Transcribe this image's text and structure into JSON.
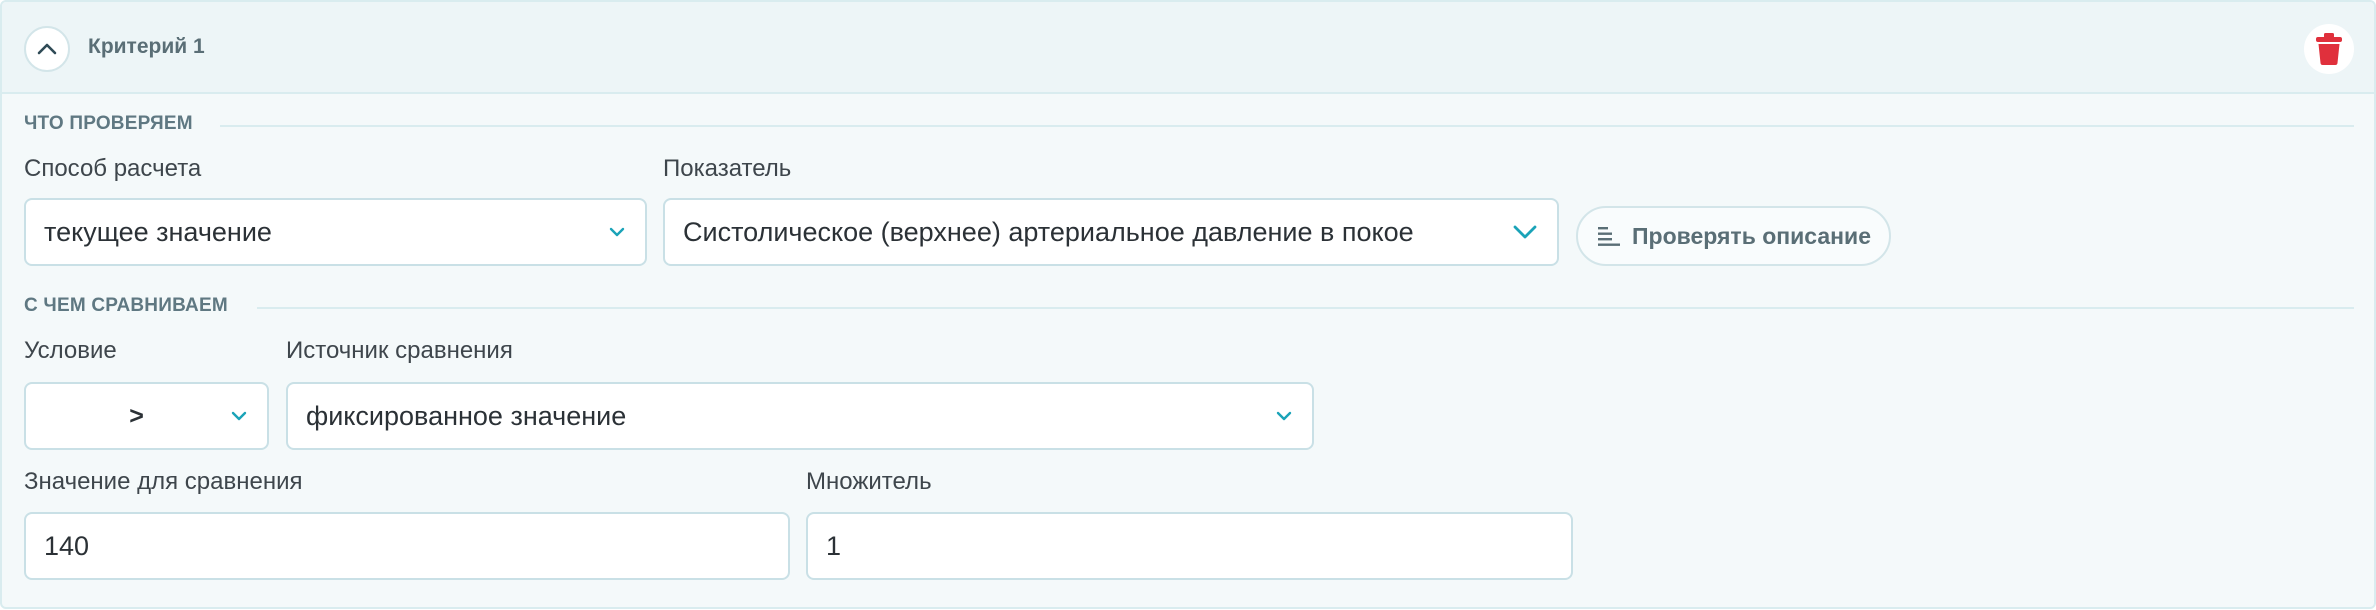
{
  "criterion": {
    "title": "Критерий 1"
  },
  "what_section": {
    "title": "ЧТО ПРОВЕРЯЕМ",
    "calc_method_label": "Способ расчета",
    "calc_method_value": "текущее значение",
    "indicator_label": "Показатель",
    "indicator_value": "Систолическое (верхнее) артериальное давление в покое",
    "check_description_button": "Проверять описание"
  },
  "compare_section": {
    "title": "С ЧЕМ СРАВНИВАЕМ",
    "condition_label": "Условие",
    "condition_value": ">",
    "source_label": "Источник сравнения",
    "source_value": "фиксированное значение",
    "compare_value_label": "Значение для сравнения",
    "compare_value": "140",
    "multiplier_label": "Множитель",
    "multiplier_value": "1"
  },
  "colors": {
    "accent": "#1aa3b8",
    "danger": "#e0303c",
    "header_bg": "#edf5f7",
    "card_bg": "#f4f9fa"
  },
  "icons": {
    "collapse": "chevron-up-icon",
    "delete": "trash-icon",
    "dropdown": "chevron-down-icon",
    "description": "text-lines-icon"
  }
}
